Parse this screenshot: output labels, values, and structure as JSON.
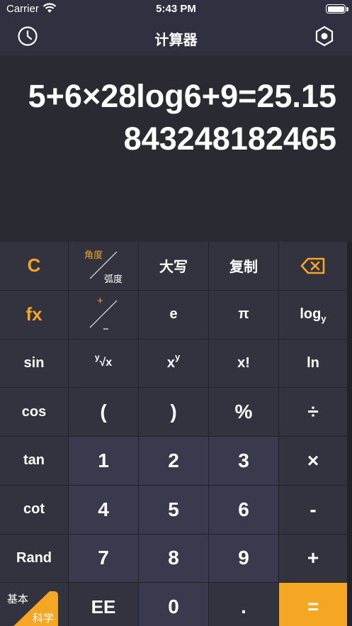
{
  "status": {
    "carrier": "Carrier",
    "time": "5:43 PM"
  },
  "nav": {
    "title": "计算器",
    "history_icon": "clock-icon",
    "settings_icon": "hexagon-gear-icon"
  },
  "display": {
    "expression": "5+6×28log6+9=25.15843248182465"
  },
  "keys": {
    "r1": [
      "C",
      "角度",
      "弧度",
      "大写",
      "复制",
      "⌫"
    ],
    "r2": [
      "fx",
      "+",
      "−",
      "e",
      "π",
      "log",
      "y"
    ],
    "r3": [
      "sin",
      "y",
      "√x",
      "x",
      "y",
      "x!",
      "ln"
    ],
    "r4": [
      "cos",
      "(",
      ")",
      "%",
      "÷"
    ],
    "r5": [
      "tan",
      "1",
      "2",
      "3",
      "×"
    ],
    "r6": [
      "cot",
      "4",
      "5",
      "6",
      "-"
    ],
    "r7": [
      "Rand",
      "7",
      "8",
      "9",
      "+"
    ],
    "r8": [
      "基本",
      "科学",
      "EE",
      "0",
      ".",
      "="
    ]
  },
  "colors": {
    "accent": "#f5a623",
    "bg": "#2a2a34",
    "key": "#33333f",
    "numkey": "#3a3a4e"
  }
}
